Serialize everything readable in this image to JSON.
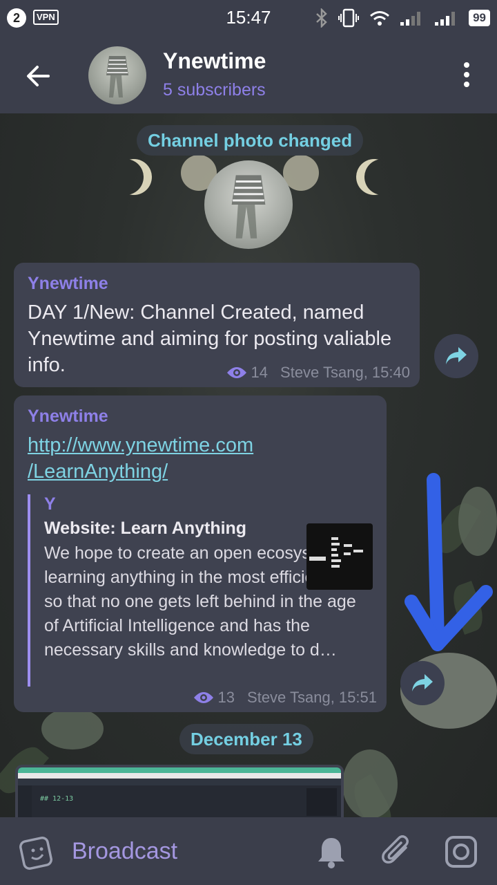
{
  "status_bar": {
    "notification_count": "2",
    "vpn": "VPN",
    "time": "15:47",
    "battery": "99"
  },
  "header": {
    "title": "Ynewtime",
    "subtitle": "5 subscribers"
  },
  "chat": {
    "service_photo": "Channel photo changed",
    "message1": {
      "author": "Ynewtime",
      "text": "DAY 1/New: Channel Created, named Ynewtime and aiming for posting valiable info.",
      "views": "14",
      "signature": "Steve Tsang, 15:40"
    },
    "message2": {
      "author": "Ynewtime",
      "link_line1": "http://www.ynewtime.com",
      "link_line2": "/LearnAnything/",
      "preview": {
        "site": "Y",
        "title": "Website: Learn Anything",
        "description": "We hope to create an open ecosystem for learning anything in the most efficient way so that no one gets left behind in the age of Artificial Intelligence and has the necessary skills and knowledge to d…"
      },
      "views": "13",
      "signature": "Steve Tsang, 15:51"
    },
    "date_pill": "December 13",
    "screenshot_code": "## 12-13"
  },
  "bottom_bar": {
    "placeholder": "Broadcast"
  },
  "colors": {
    "accent_purple": "#8e80e8",
    "link_cyan": "#7ed3e3",
    "bubble": "#3f4250",
    "bars": "#3b3e4b",
    "annotation_arrow": "#3361e6"
  }
}
